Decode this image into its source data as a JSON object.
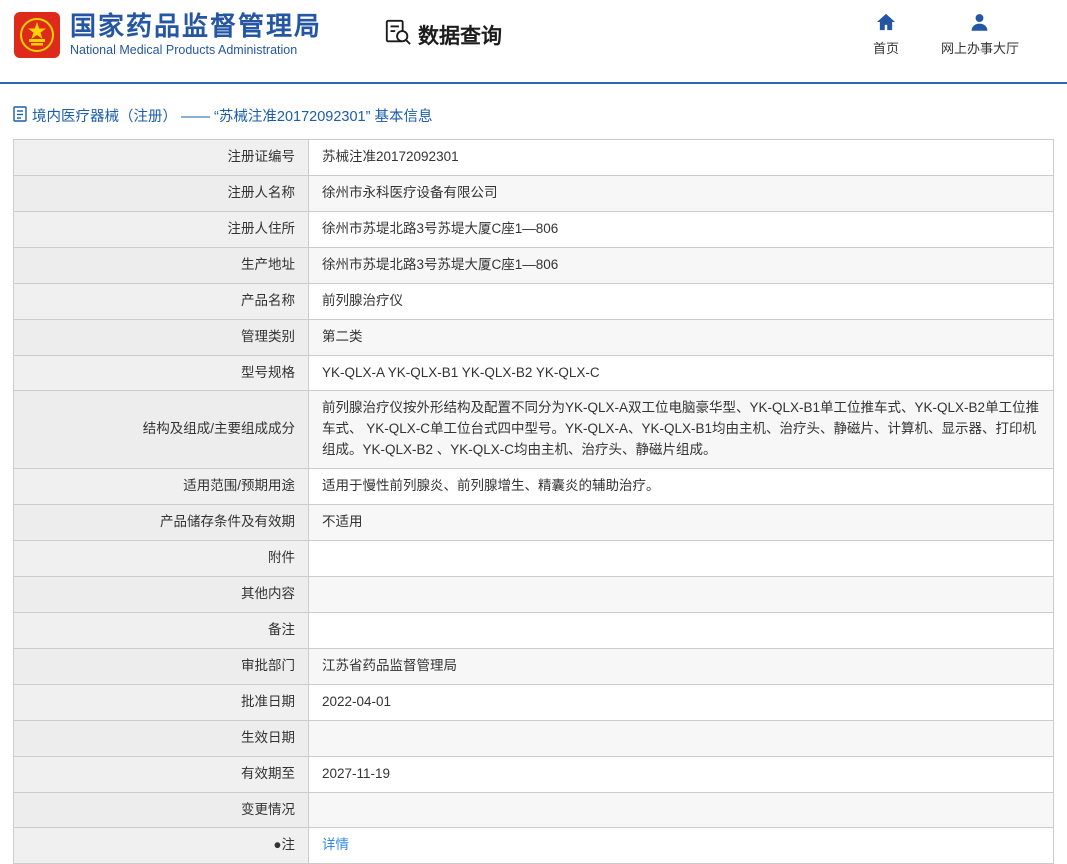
{
  "header": {
    "org_name_cn": "国家药品监督管理局",
    "org_name_en": "National Medical Products Administration",
    "section_title": "数据查询",
    "nav": [
      {
        "label": "首页",
        "icon": "home-icon"
      },
      {
        "label": "网上办事大厅",
        "icon": "person-icon"
      }
    ]
  },
  "breadcrumb": {
    "text": "境内医疗器械（注册） —— “苏械注准20172092301” 基本信息"
  },
  "colors": {
    "brand_blue": "#2456a4",
    "link_blue": "#2e8ae6",
    "logo_red": "#de2a1b",
    "logo_gold": "#ffd200"
  },
  "table": {
    "rows": [
      {
        "label": "注册证编号",
        "value": "苏械注准20172092301"
      },
      {
        "label": "注册人名称",
        "value": "徐州市永科医疗设备有限公司"
      },
      {
        "label": "注册人住所",
        "value": "徐州市苏堤北路3号苏堤大厦C座1—806"
      },
      {
        "label": "生产地址",
        "value": "徐州市苏堤北路3号苏堤大厦C座1—806"
      },
      {
        "label": "产品名称",
        "value": "前列腺治疗仪"
      },
      {
        "label": "管理类别",
        "value": "第二类"
      },
      {
        "label": "型号规格",
        "value": "YK-QLX-A YK-QLX-B1 YK-QLX-B2 YK-QLX-C"
      },
      {
        "label": "结构及组成/主要组成成分",
        "value": "前列腺治疗仪按外形结构及配置不同分为YK-QLX-A双工位电脑豪华型、YK-QLX-B1单工位推车式、YK-QLX-B2单工位推车式、 YK-QLX-C单工位台式四中型号。YK-QLX-A、YK-QLX-B1均由主机、治疗头、静磁片、计算机、显示器、打印机组成。YK-QLX-B2 、YK-QLX-C均由主机、治疗头、静磁片组成。"
      },
      {
        "label": "适用范围/预期用途",
        "value": "适用于慢性前列腺炎、前列腺增生、精囊炎的辅助治疗。"
      },
      {
        "label": "产品储存条件及有效期",
        "value": "不适用"
      },
      {
        "label": "附件",
        "value": ""
      },
      {
        "label": "其他内容",
        "value": ""
      },
      {
        "label": "备注",
        "value": ""
      },
      {
        "label": "审批部门",
        "value": "江苏省药品监督管理局"
      },
      {
        "label": "批准日期",
        "value": "2022-04-01"
      },
      {
        "label": "生效日期",
        "value": ""
      },
      {
        "label": "有效期至",
        "value": "2027-11-19"
      },
      {
        "label": "变更情况",
        "value": ""
      },
      {
        "label": "●注",
        "value": "详情",
        "link": true
      }
    ]
  }
}
